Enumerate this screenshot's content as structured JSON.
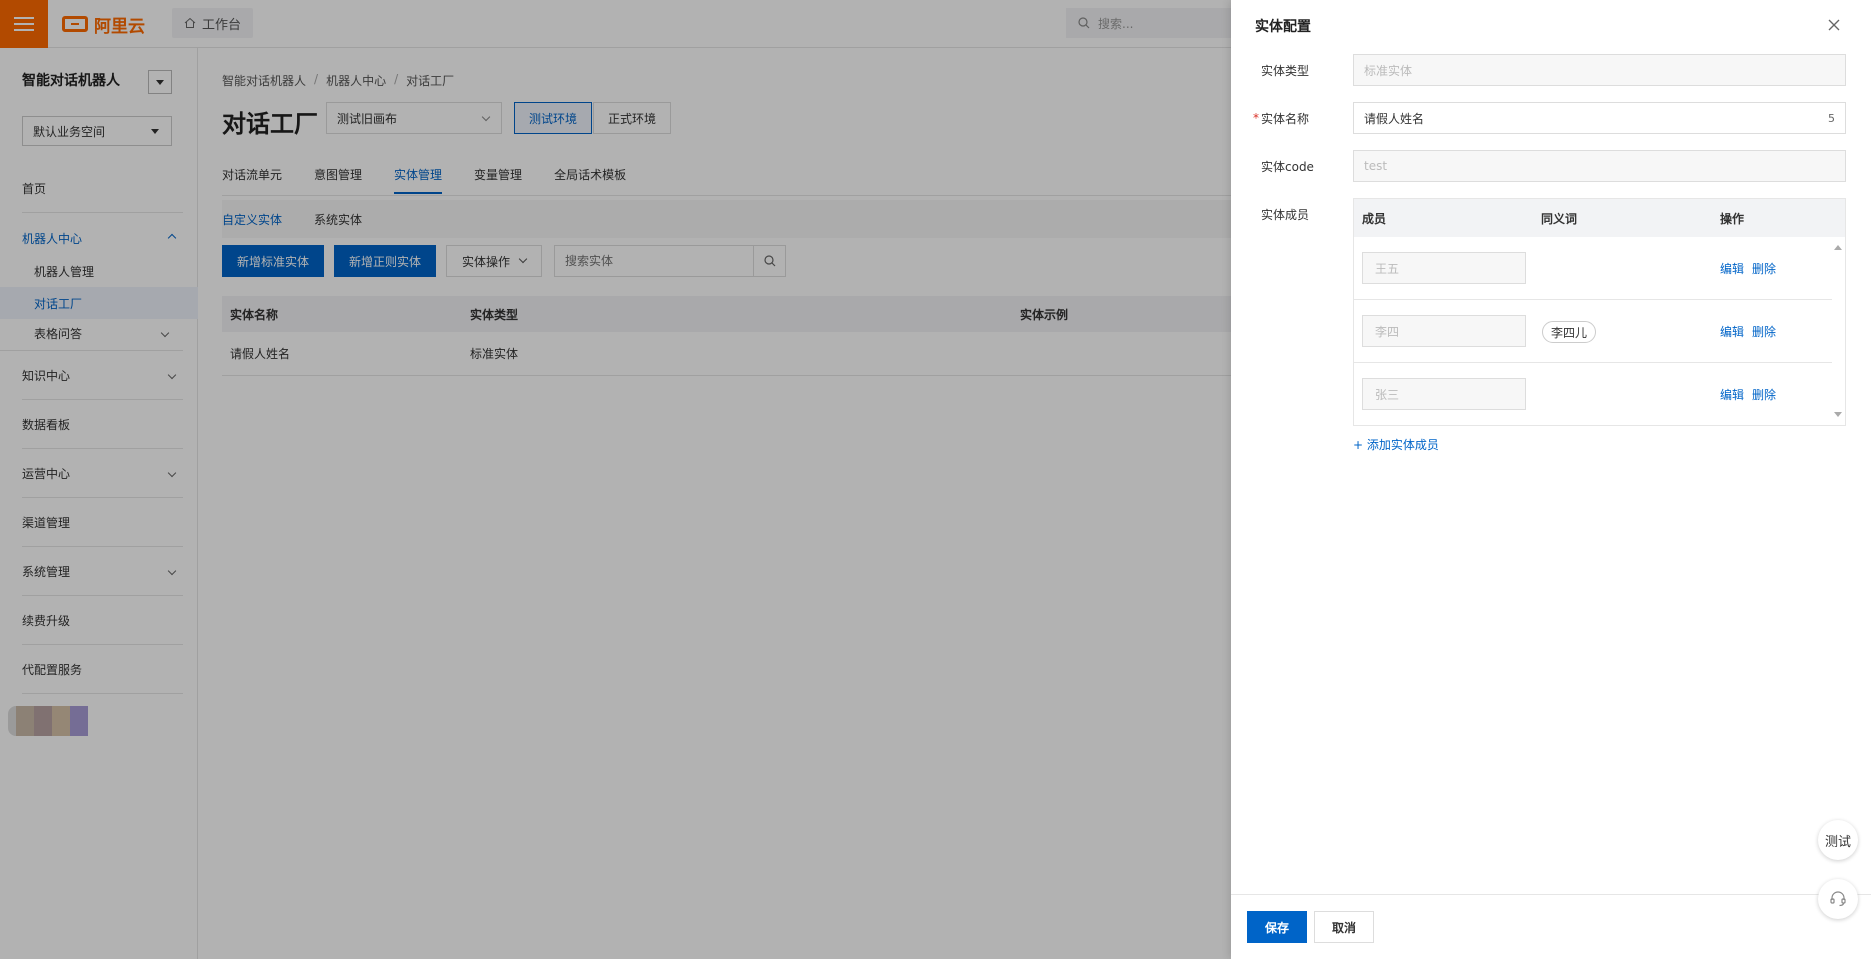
{
  "topbar": {
    "logo_text": "阿里云",
    "workbench_label": "工作台",
    "search_placeholder": "搜索..."
  },
  "sidebar": {
    "title": "智能对话机器人",
    "space_select": "默认业务空间",
    "items": [
      {
        "label": "首页"
      },
      {
        "label": "机器人中心"
      },
      {
        "label": "机器人管理"
      },
      {
        "label": "对话工厂"
      },
      {
        "label": "表格问答"
      },
      {
        "label": "知识中心"
      },
      {
        "label": "数据看板"
      },
      {
        "label": "运营中心"
      },
      {
        "label": "渠道管理"
      },
      {
        "label": "系统管理"
      },
      {
        "label": "续费升级"
      },
      {
        "label": "代配置服务"
      }
    ]
  },
  "main": {
    "breadcrumb": [
      "智能对话机器人",
      "机器人中心",
      "对话工厂"
    ],
    "page_title": "对话工厂",
    "env_select": "测试旧画布",
    "env_test": "测试环境",
    "env_prod": "正式环境",
    "tabs": [
      "对话流单元",
      "意图管理",
      "实体管理",
      "变量管理",
      "全局话术模板"
    ],
    "subtabs": [
      "自定义实体",
      "系统实体"
    ],
    "btn_new_standard": "新增标准实体",
    "btn_new_regex": "新增正则实体",
    "btn_entity_ops": "实体操作",
    "search_placeholder": "搜索实体",
    "table_headers": [
      "实体名称",
      "实体类型",
      "实体示例"
    ],
    "table_rows": [
      {
        "name": "请假人姓名",
        "type": "标准实体"
      }
    ]
  },
  "drawer": {
    "title": "实体配置",
    "type_label": "实体类型",
    "type_value": "标准实体",
    "name_label": "实体名称",
    "name_value": "请假人姓名",
    "name_count": "5",
    "code_label": "实体code",
    "code_value": "test",
    "members_label": "实体成员",
    "members_headers": [
      "成员",
      "同义词",
      "操作"
    ],
    "members": [
      {
        "member": "王五",
        "synonym": "",
        "edit": "编辑",
        "delete": "删除"
      },
      {
        "member": "李四",
        "synonym": "李四儿",
        "edit": "编辑",
        "delete": "删除"
      },
      {
        "member": "张三",
        "synonym": "",
        "edit": "编辑",
        "delete": "删除"
      }
    ],
    "add_member": "+ 添加实体成员",
    "save": "保存",
    "cancel": "取消"
  },
  "floating": {
    "test_label": "测试"
  },
  "colors": {
    "brand_orange": "#ff6a00",
    "primary_blue": "#0064c8",
    "required_red": "#d93026"
  }
}
